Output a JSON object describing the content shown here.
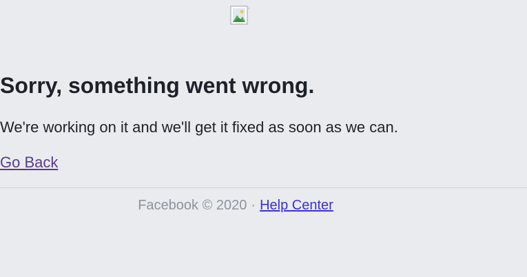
{
  "error": {
    "title": "Sorry, something went wrong.",
    "message": "We're working on it and we'll get it fixed as soon as we can.",
    "back_link_label": "Go Back"
  },
  "footer": {
    "copyright": "Facebook © 2020",
    "separator": "·",
    "help_link_label": "Help Center"
  },
  "colors": {
    "background": "#e9ebee",
    "visited_link": "#5a3a8c",
    "link": "#3b2fd4",
    "muted_text": "#8d949e"
  },
  "icons": {
    "broken_image": "broken-image-icon"
  }
}
